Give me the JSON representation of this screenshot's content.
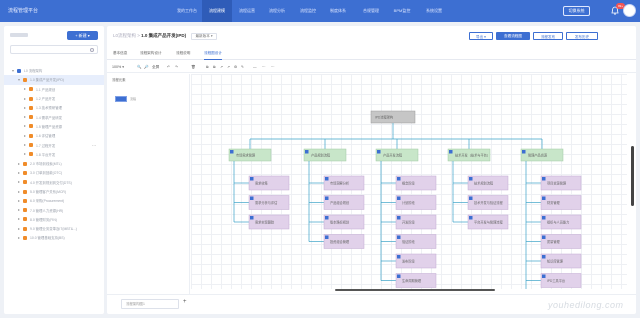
{
  "app": {
    "brand": "流程管理平台",
    "nav": [
      "我的工作台",
      "流程建模",
      "流程运营",
      "流程分析",
      "流程监控",
      "制度体系",
      "合规管理",
      "BPM监控",
      "系统设置"
    ],
    "nav_active_index": 1,
    "switch_button": "切换系统",
    "notification_count": "99+"
  },
  "sidebar": {
    "title": "流程架构",
    "new_button": "+ 新建 ▾",
    "search_placeholder": "",
    "items": [
      {
        "label": "L0 流程架构",
        "level": 0,
        "color": "#3d6fd2",
        "expanded": true,
        "selected": false
      },
      {
        "label": "1.0 集成产品开发(IPD)",
        "level": 1,
        "color": "#f08c2a",
        "expanded": true,
        "selected": true
      },
      {
        "label": "1.1 产品规划",
        "level": 2,
        "color": "#f08c2a",
        "expanded": false,
        "selected": false
      },
      {
        "label": "1.2 产品开发",
        "level": 2,
        "color": "#f08c2a",
        "expanded": false,
        "selected": false
      },
      {
        "label": "1.3 技术预研管理",
        "level": 2,
        "color": "#f08c2a",
        "expanded": false,
        "selected": false
      },
      {
        "label": "1.4 需求产品研发",
        "level": 2,
        "color": "#f08c2a",
        "expanded": false,
        "selected": false
      },
      {
        "label": "1.5 管理产品资源",
        "level": 2,
        "color": "#f08c2a",
        "expanded": false,
        "selected": false
      },
      {
        "label": "1.6 评估管理",
        "level": 2,
        "color": "#f08c2a",
        "expanded": false,
        "selected": false
      },
      {
        "label": "1.7 过程开发",
        "level": 2,
        "color": "#f08c2a",
        "expanded": false,
        "selected": false,
        "more": "···"
      },
      {
        "label": "1.8 平台开发",
        "level": 2,
        "color": "#f08c2a",
        "expanded": false,
        "selected": false
      },
      {
        "label": "2.0 市场到线索(MTL)",
        "level": 1,
        "color": "#f08c2a",
        "expanded": false,
        "selected": false
      },
      {
        "label": "3.0 订单到回款(OTC)",
        "level": 1,
        "color": "#f08c2a",
        "expanded": false,
        "selected": false
      },
      {
        "label": "4.0 开发到规划到交付(DTS)",
        "level": 1,
        "color": "#f08c2a",
        "expanded": false,
        "selected": false
      },
      {
        "label": "5.0 管理客户关系(MCR)",
        "level": 1,
        "color": "#f08c2a",
        "expanded": false,
        "selected": false
      },
      {
        "label": "6.0 采购(Procurement)",
        "level": 1,
        "color": "#f08c2a",
        "expanded": false,
        "selected": false
      },
      {
        "label": "7.0 管理人力资源(HR)",
        "level": 1,
        "color": "#f08c2a",
        "expanded": false,
        "selected": false
      },
      {
        "label": "8.0 管理财务(FIN)",
        "level": 1,
        "color": "#f08c2a",
        "expanded": false,
        "selected": false
      },
      {
        "label": "9.0 管理业务变革及IT(MBT&...)",
        "level": 1,
        "color": "#f08c2a",
        "expanded": false,
        "selected": false
      },
      {
        "label": "10.0 管理基础支持(BS)",
        "level": 1,
        "color": "#f08c2a",
        "expanded": false,
        "selected": false
      }
    ]
  },
  "main": {
    "breadcrumb_parent": "L0流程架构",
    "title": "1.0 集成产品开发(IPD)",
    "version": "最新版本 ▾",
    "actions": [
      "导出 ▾",
      "查看流程图",
      "流程发布",
      "发布历史"
    ],
    "tabs": [
      "基本信息",
      "流程架构设计",
      "流程说明",
      "流程图设计"
    ],
    "active_tab": 3,
    "toolbar": [
      "100% ▾",
      "🔍",
      "🔎",
      "全屏",
      "↶",
      "↷",
      "🗑",
      "⧉",
      "⧉",
      "↗",
      "↗",
      "⚙",
      "✎",
      "—",
      "⋯",
      "⋯"
    ],
    "left_panel_title": "流程元素",
    "left_panel_item": "流程",
    "page_tab": "流程架构图1",
    "add_page": "+"
  },
  "diagram": {
    "root": {
      "label": "IPD流程架构",
      "color": "#c6c6c6"
    },
    "groups": [
      {
        "label": "市场需求管理",
        "children": [
          "需求收集",
          "需求分析与评估",
          "需求实现跟踪"
        ]
      },
      {
        "label": "产品规划流程",
        "children": [
          "市场洞察分析",
          "产品组合规划",
          "版本路标规划",
          "投资组合管理"
        ]
      },
      {
        "label": "产品开发流程",
        "children": [
          "概念阶段",
          "计划阶段",
          "开发阶段",
          "验证阶段",
          "发布阶段",
          "生命周期管理"
        ]
      },
      {
        "label": "技术开发（技术与平台）",
        "children": [
          "技术规划流程",
          "技术开发与验证流程",
          "平台开发与管理流程"
        ]
      },
      {
        "label": "管理产品资源",
        "children": [
          "项目资源管理",
          "财务管理",
          "组织与人员能力",
          "质量管理",
          "知识库管理",
          "IPD工具平台",
          "考评与激励体系"
        ]
      }
    ],
    "colors": {
      "group": "#c8e6c9",
      "child": "#e1d1ea",
      "edge": "#3aa3c8",
      "icon": "#3d6fd2"
    }
  },
  "watermark": "youhedilong.com"
}
